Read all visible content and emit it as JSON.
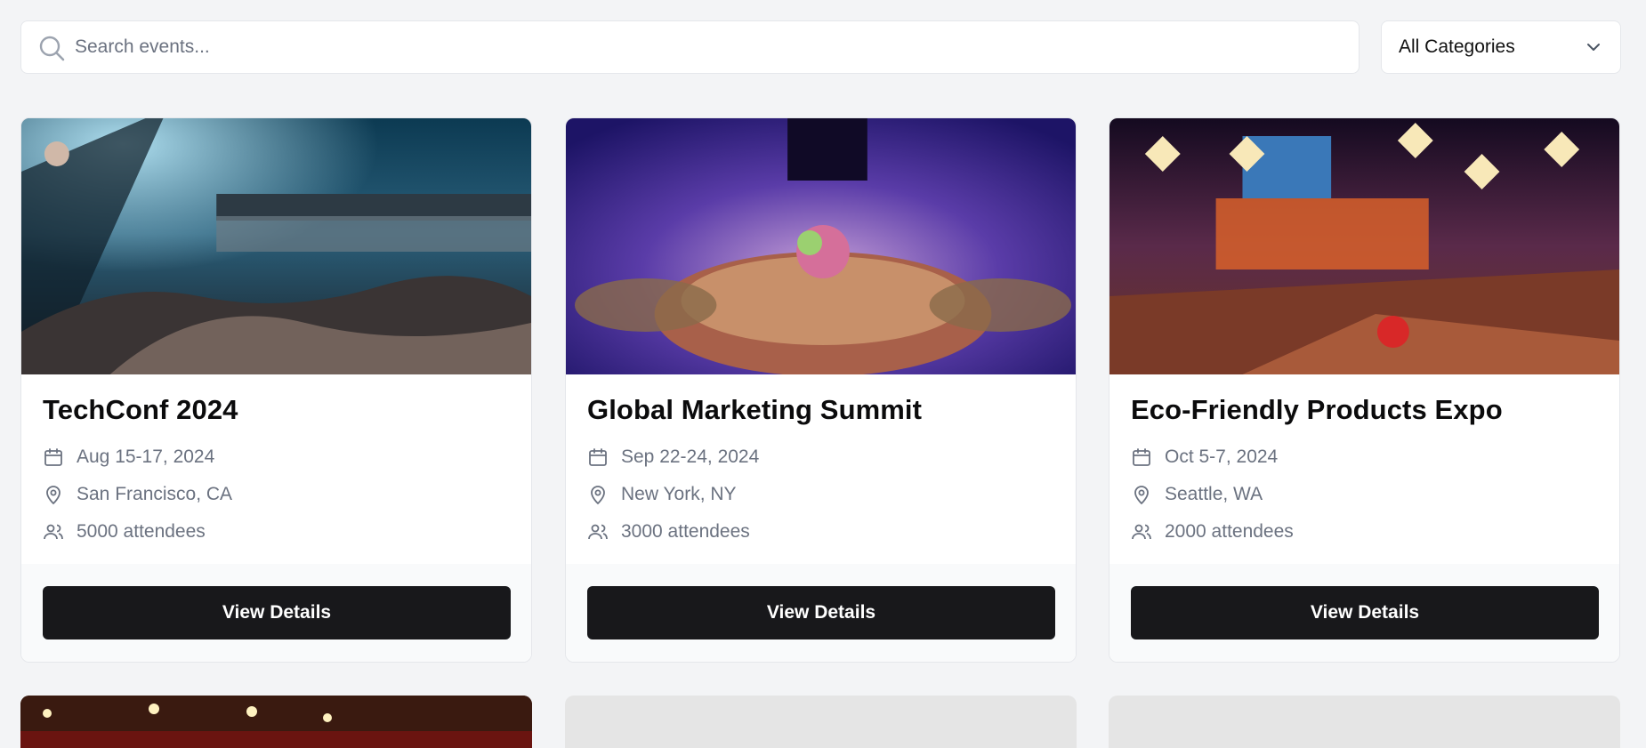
{
  "search": {
    "placeholder": "Search events..."
  },
  "filter": {
    "selected": "All Categories"
  },
  "events": [
    {
      "title": "TechConf 2024",
      "date": "Aug 15-17, 2024",
      "location": "San Francisco, CA",
      "attendees": "5000 attendees",
      "button": "View Details",
      "image": "concert-crowd-photo"
    },
    {
      "title": "Global Marketing Summit",
      "date": "Sep 22-24, 2024",
      "location": "New York, NY",
      "attendees": "3000 attendees",
      "button": "View Details",
      "image": "banquet-tables-photo"
    },
    {
      "title": "Eco-Friendly Products Expo",
      "date": "Oct 5-7, 2024",
      "location": "Seattle, WA",
      "attendees": "2000 attendees",
      "button": "View Details",
      "image": "gala-dinner-hall-photo"
    }
  ],
  "icons": {
    "search": "search-icon",
    "chevron": "chevron-down-icon",
    "date": "calendar-icon",
    "location": "map-pin-icon",
    "attendees": "users-icon"
  },
  "colors": {
    "button_bg": "#18181b",
    "page_bg": "#f3f4f6"
  }
}
